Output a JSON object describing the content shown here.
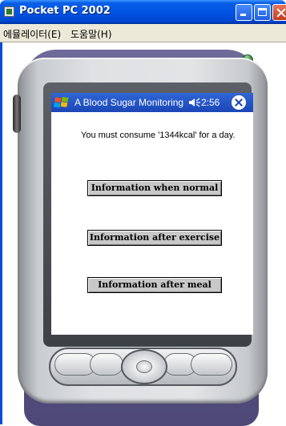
{
  "window": {
    "title": "Pocket PC 2002",
    "menu": [
      "에뮬레이터(E)",
      "도움말(H)"
    ]
  },
  "pda": {
    "title_bar": {
      "app_title": "A Blood Sugar Monitoring",
      "time": "2:56"
    },
    "message": "You must consume '1344kcal' for a day.",
    "buttons": {
      "normal": "Information when normal",
      "exercise": "Information after exercise",
      "meal": "Information after meal"
    }
  },
  "icons": {
    "app_icon": "emulator-icon",
    "start_flag": "windows-flag-icon",
    "volume": "speaker-icon",
    "close": "close-icon"
  },
  "colors": {
    "xp_title": "#0054e3",
    "pda_title": "#1b46b6",
    "device_body": "#d8dadd",
    "device_back": "#5b5686",
    "stylus": "#3c8f3c"
  }
}
